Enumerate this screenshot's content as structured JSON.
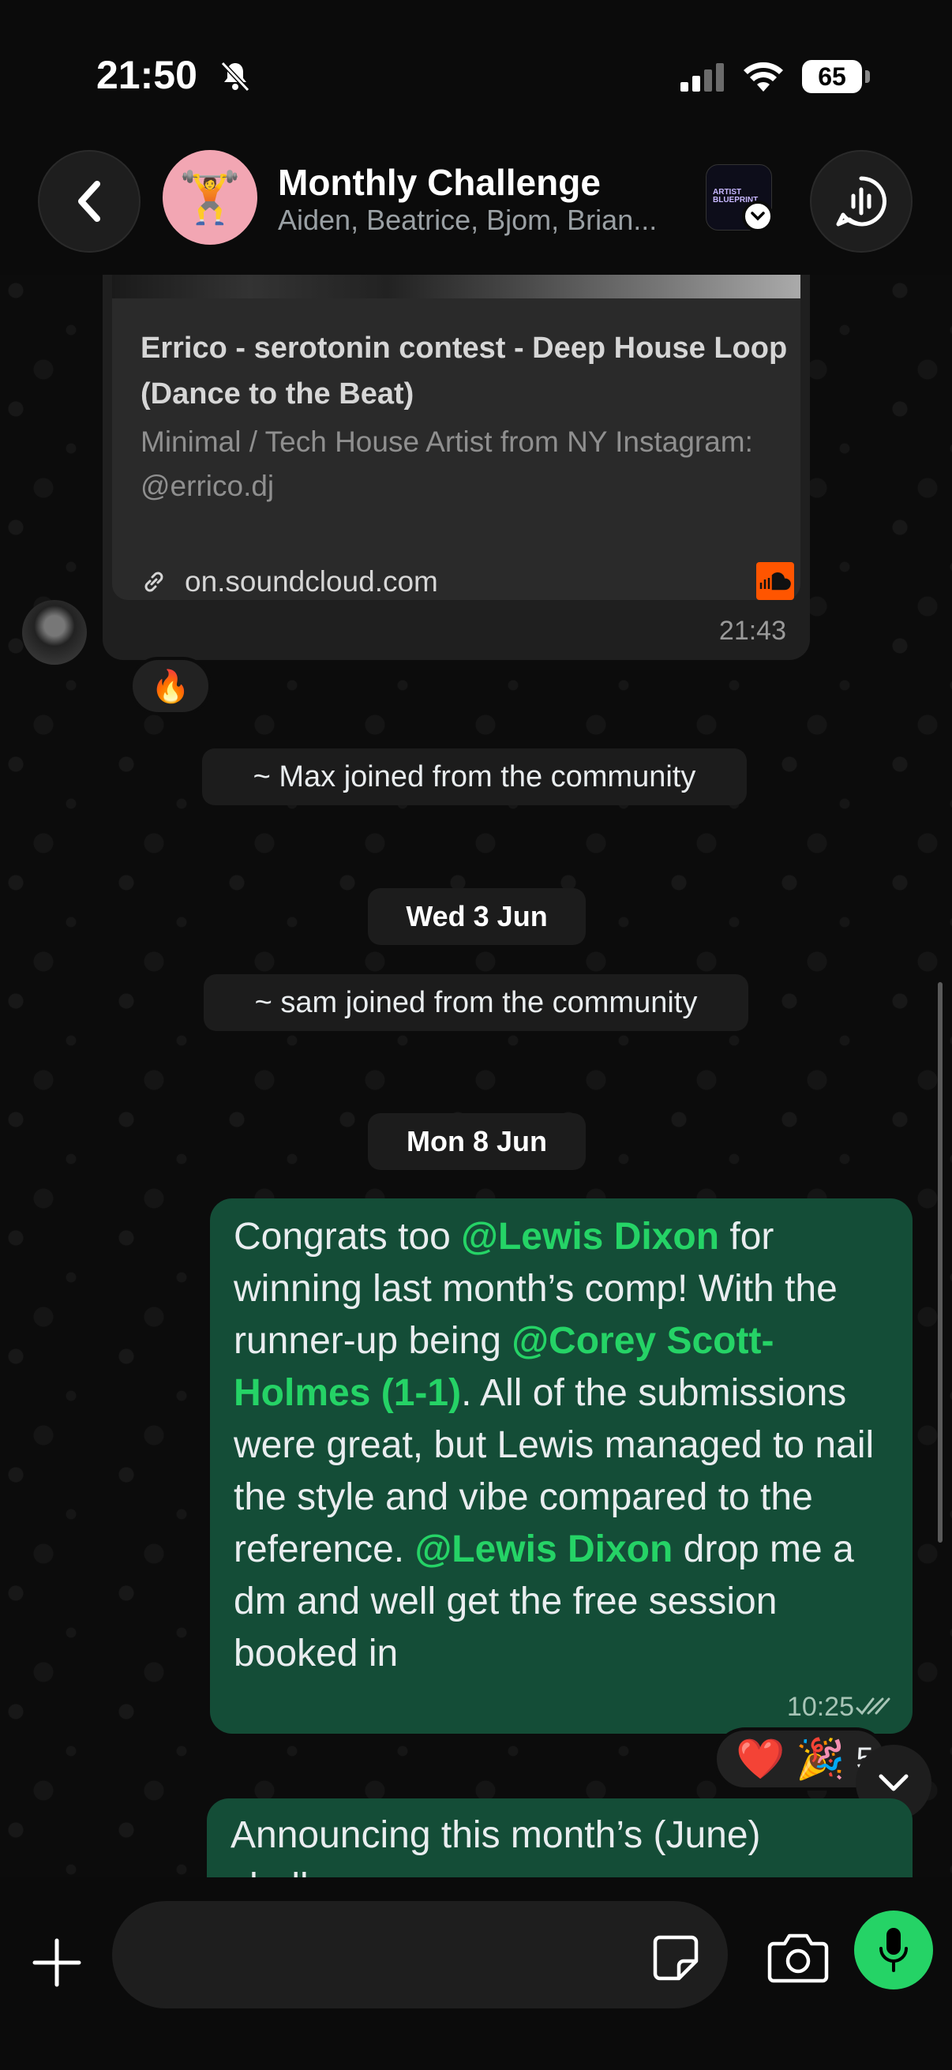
{
  "status_bar": {
    "time": "21:50",
    "battery": "65"
  },
  "header": {
    "title": "Monthly Challenge",
    "participants": "Aiden, Beatrice, Bjom, Brian...",
    "avatar_emoji": "🏋️",
    "community_thumb_text": "ARTIST BLUEPRINT"
  },
  "link_message": {
    "title": "Errico - serotonin contest - Deep House Loop (Dance to the Beat)",
    "description": "Minimal / Tech House Artist from NY Instagram: @errico.dj",
    "domain": "on.soundcloud.com",
    "time": "21:43",
    "reaction": "🔥"
  },
  "system_messages": {
    "max_joined": "~ Max joined from the community",
    "sam_joined": "~ sam joined from the community"
  },
  "dates": {
    "wed": "Wed 3 Jun",
    "mon": "Mon 8 Jun"
  },
  "announcement": {
    "part1": "Congrats too ",
    "mention1": "@Lewis Dixon",
    "part2": " for winning last month’s comp! With the runner-up being ",
    "mention2": "@Corey Scott-Holmes (1-1)",
    "part3": ". All of the submissions were great, but Lewis managed to nail the style and vibe compared to the reference. ",
    "mention3": "@Lewis Dixon",
    "part4": " drop me a dm and well get the free session booked in",
    "time": "10:25",
    "reaction_heart": "❤️",
    "reaction_party": "🎉",
    "reaction_count": "5"
  },
  "next_message": {
    "text": "Announcing this month’s (June) challenge"
  },
  "input": {
    "placeholder": ""
  },
  "colors": {
    "accent": "#25d366",
    "outgoing_bubble": "#144d37"
  }
}
